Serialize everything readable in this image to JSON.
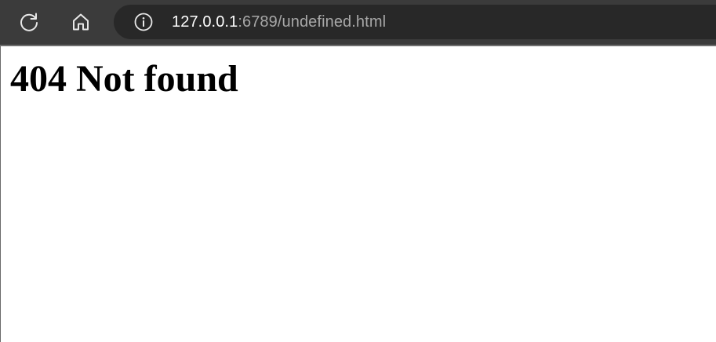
{
  "toolbar": {
    "reload_icon": "reload-icon",
    "home_icon": "home-icon",
    "info_icon": "info-icon"
  },
  "address_bar": {
    "host": "127.0.0.1",
    "rest": ":6789/undefined.html"
  },
  "page": {
    "heading": "404 Not found"
  },
  "colors": {
    "toolbar_bg": "#3b3b3b",
    "address_bar_bg": "#282828",
    "url_host": "#ffffff",
    "url_rest": "#a7a7a7",
    "page_bg": "#ffffff",
    "heading_text": "#000000"
  }
}
